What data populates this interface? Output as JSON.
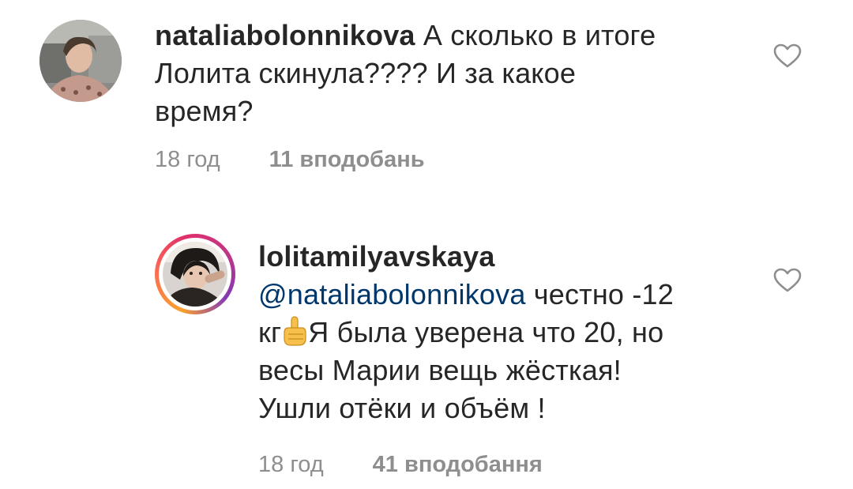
{
  "comments": [
    {
      "username": "nataliabolonnikova",
      "line1": "А сколько в итоге",
      "line2": "Лолита скинула???? И за какое",
      "line3": "время?",
      "time": "18 год",
      "likes": "11 вподобань",
      "avatar_icon": "user-photo",
      "like_icon": "heart-outline-icon"
    },
    {
      "username": "lolitamilyavskaya",
      "mention": "@nataliabolonnikova",
      "line1_rest": "честно -12",
      "line2_start": "кг",
      "emoji": "point-up-emoji",
      "line2_rest": "Я была уверена что 20, но",
      "line3": "весы Марии вещь жёсткая!",
      "line4": "Ушли отёки и объём !",
      "time": "18 год",
      "likes": "41 вподобання",
      "avatar_icon": "user-photo",
      "has_story_ring": true,
      "like_icon": "heart-outline-icon"
    }
  ],
  "colors": {
    "text": "#262626",
    "secondary": "#8e8e8e",
    "mention": "#00376b",
    "background": "#ffffff"
  }
}
